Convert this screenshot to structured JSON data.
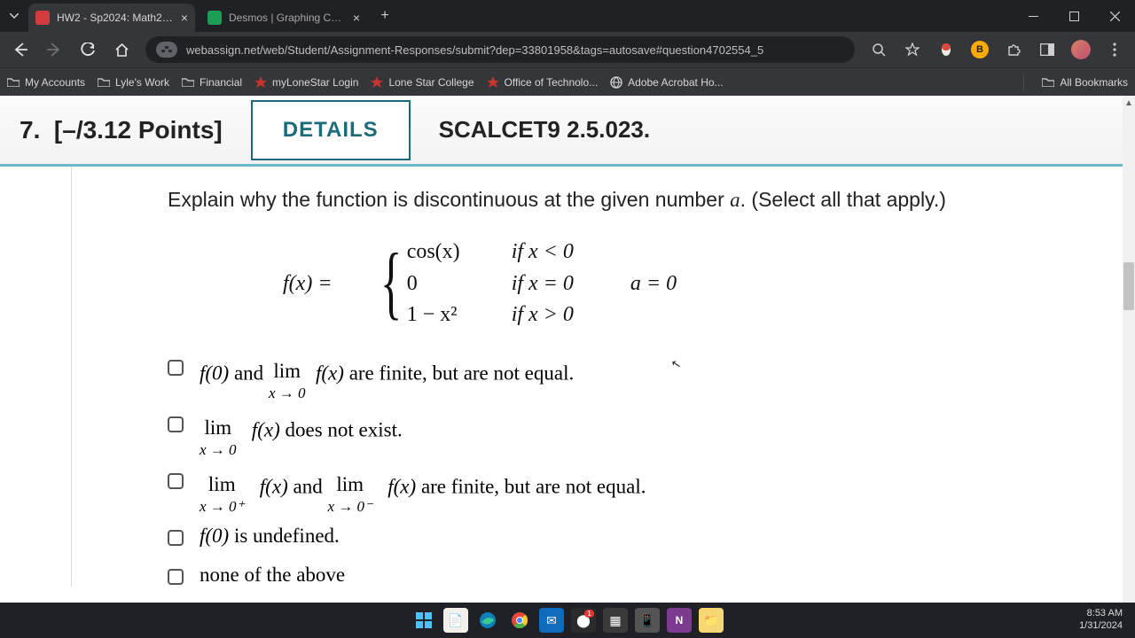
{
  "browser": {
    "tabs": [
      {
        "title": "HW2 - Sp2024: Math2413-2…",
        "favicon_bg": "#d23c3c"
      },
      {
        "title": "Desmos | Graphing Calculat…",
        "favicon_bg": "#1a9e55"
      }
    ],
    "url": "webassign.net/web/Student/Assignment-Responses/submit?dep=33801958&tags=autosave#question4702554_5",
    "ext_badge": "B",
    "bookmarks": [
      "My Accounts",
      "Lyle's Work",
      "Financial",
      "myLoneStar Login",
      "Lone Star College",
      "Office of Technolo...",
      "Adobe Acrobat Ho..."
    ],
    "all_bookmarks": "All Bookmarks"
  },
  "question": {
    "number": "7.",
    "points": "[–/3.12 Points]",
    "details_label": "DETAILS",
    "ref": "SCALCET9 2.5.023.",
    "prompt_pre": "Explain why the function is discontinuous at the given number ",
    "prompt_var": "a",
    "prompt_post": ". (Select all that apply.)",
    "func_lhs": "f(x) = ",
    "pieces": [
      {
        "expr": "cos(x)",
        "cond": "if x < 0"
      },
      {
        "expr": "0",
        "cond": "if x = 0"
      },
      {
        "expr": "1 − x²",
        "cond": "if x > 0"
      }
    ],
    "a_label": "a = 0",
    "options": {
      "o1_a": "f(0) and ",
      "o1_limtop": "lim",
      "o1_limbot": "x → 0",
      "o1_b": " f(x) are finite, but are not equal.",
      "o2_limtop": "lim",
      "o2_limbot": "x → 0",
      "o2_b": " f(x) does not exist.",
      "o3_lim1top": "lim",
      "o3_lim1bot": "x → 0⁺",
      "o3_mid": " f(x) and ",
      "o3_lim2top": "lim",
      "o3_lim2bot": "x → 0⁻",
      "o3_end": " f(x) are finite, but are not equal.",
      "o4": "f(0) is undefined.",
      "o5": "none of the above"
    }
  },
  "system": {
    "time": "8:53 AM",
    "date": "1/31/2024"
  }
}
